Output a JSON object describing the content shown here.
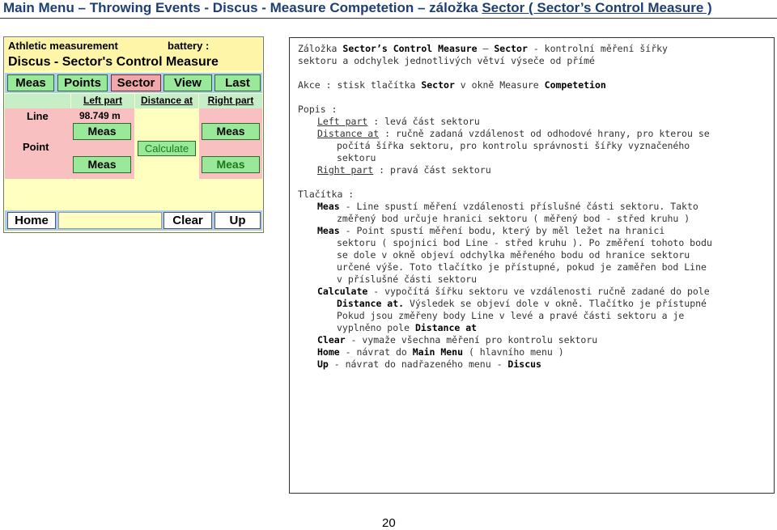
{
  "header": {
    "prefix": "Main Menu – Throwing Events - Discus - Measure Competetion – záložka ",
    "tab_name": "Sector ( Sector’s Control  Measure )"
  },
  "device": {
    "app_name": "Athletic measurement",
    "battery_label": "battery :",
    "screen_title": "Discus - Sector's Control Measure",
    "tabs": [
      "Meas",
      "Points",
      "Sector",
      "View",
      "Last"
    ],
    "active_tab": "Sector",
    "col_headers": {
      "left": "Left part",
      "distance": "Distance at",
      "right": "Right part"
    },
    "line_label": "Line",
    "distance_value": "98.749 m",
    "point_label": "Point",
    "meas_label": "Meas",
    "calculate_label": "Calculate",
    "bottom": {
      "home": "Home",
      "clear": "Clear",
      "up": "Up"
    }
  },
  "panel": {
    "l1a": "Záložka ",
    "l1b": "Sector’s Control Measure",
    "l1c": " – ",
    "l1d": "Sector",
    "l1e": " - kontrolní měření šířky",
    "l2": "sektoru a odchylek jednotlivých větví výseče od přímé",
    "l3a": "Akce  : stisk tlačítka ",
    "l3b": "Sector",
    "l3c": " v okně Measure ",
    "l3d": "Competetion",
    "l4": "Popis :",
    "l5a": "Left part",
    "l5b": " : levá část sektoru",
    "l6a": "Distance at",
    "l6b": " : ručně zadaná vzdálenost od odhodové hrany, pro kterou se",
    "l7": "počítá šířka sektoru, pro kontrolu správnosti šířky vyznačeného",
    "l8": "sektoru",
    "l9a": "Right part",
    "l9b": " : pravá část sektoru",
    "l10": "Tlačítka :",
    "l11a": "Meas",
    "l11b": " - Line spustí měření vzdálenosti příslušné části sektoru. Takto",
    "l12": "změřený bod určuje hranici sektoru ( měřený bod - střed kruhu )",
    "l13a": "Meas",
    "l13b": " - Point spustí měření bodu, který by měl ležet na hranici",
    "l14": "sektoru ( spojnici bod Line - střed kruhu ). Po změření tohoto bodu",
    "l15": "se dole v okně objeví odchylka měřeného bodu od hranice sektoru",
    "l16": "určené výše. Toto tlačítko je přístupné, pokud je zaměřen bod Line",
    "l17": "v příslušné části sektoru",
    "l18a": "Calculate",
    "l18b": " - vypočítá šířku sektoru ve vzdálenosti ručně zadané do pole",
    "l19a": "Distance at.",
    "l19b": " Výsledek se objeví dole v okně. Tlačítko je přístupné",
    "l20": "Pokud jsou změřeny body Line v levé a pravé části sektoru a je",
    "l21a": "vyplněno pole ",
    "l21b": "Distance at",
    "l22a": "Clear",
    "l22b": " - vymaže všechna měření pro kontrolu sektoru",
    "l23a": "Home",
    "l23b": " - návrat do ",
    "l23c": "Main Menu",
    "l23d": " ( hlavního menu )",
    "l24a": "Up",
    "l24b": " - návrat do nadřazeného menu - ",
    "l24c": "Discus"
  },
  "page_number": "20"
}
